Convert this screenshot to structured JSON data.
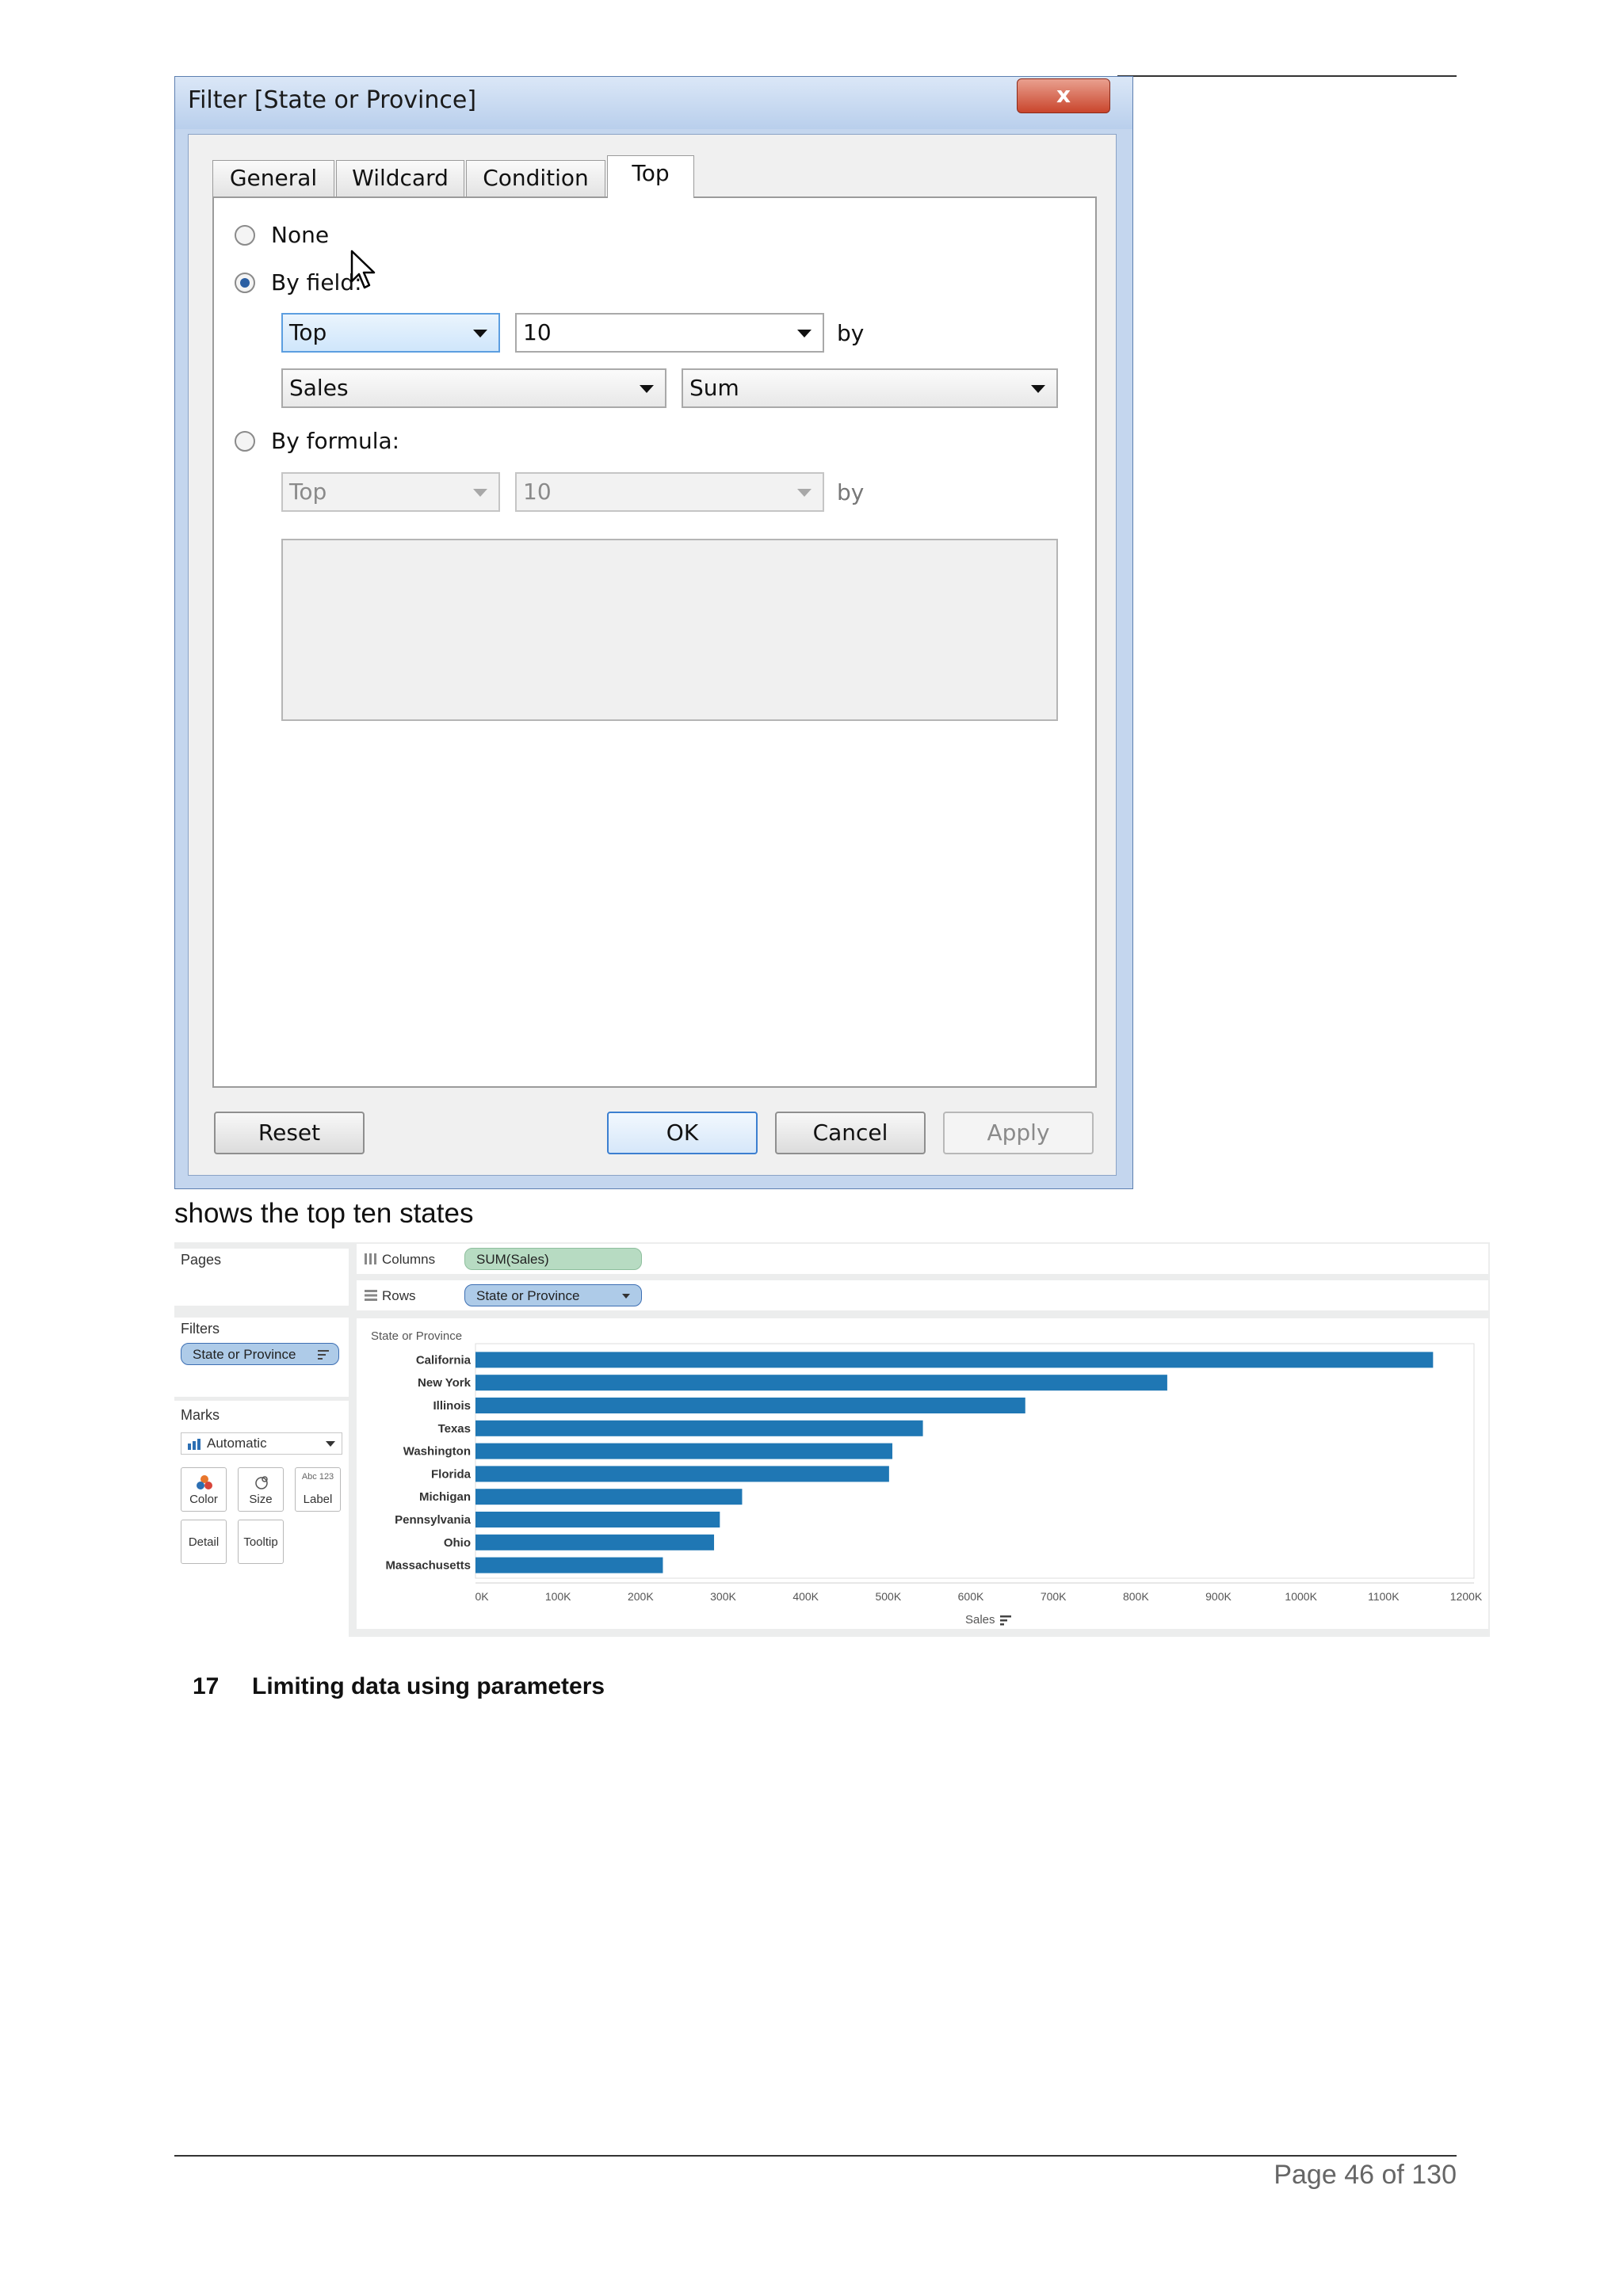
{
  "dialog": {
    "title": "Filter [State or Province]",
    "close_glyph": "x",
    "tabs": [
      {
        "label": "General"
      },
      {
        "label": "Wildcard"
      },
      {
        "label": "Condition"
      },
      {
        "label": "Top"
      }
    ],
    "active_tab": "Top",
    "options": {
      "none_label": "None",
      "by_field_label": "By field:",
      "by_formula_label": "By formula:",
      "selected": "By field:"
    },
    "by_field": {
      "direction": "Top",
      "count": "10",
      "by": "by",
      "field": "Sales",
      "aggregation": "Sum"
    },
    "by_formula": {
      "direction": "Top",
      "count": "10",
      "by": "by",
      "formula": ""
    },
    "buttons": {
      "reset": "Reset",
      "ok": "OK",
      "cancel": "Cancel",
      "apply": "Apply"
    }
  },
  "caption": "shows the top ten states",
  "tableau": {
    "pages_label": "Pages",
    "filters_label": "Filters",
    "filter_pill": "State or Province",
    "marks_label": "Marks",
    "mark_type": "Automatic",
    "mark_cards": [
      "Color",
      "Size",
      "Label",
      "Detail",
      "Tooltip"
    ],
    "label_icon_text": "Abc 123",
    "columns_label": "Columns",
    "columns_pill": "SUM(Sales)",
    "rows_label": "Rows",
    "rows_pill": "State or Province",
    "colors": {
      "bar": "#1f77b4",
      "columns_pill": "#b7dbc2",
      "rows_pill": "#aecbe8"
    }
  },
  "chart_data": {
    "type": "bar",
    "orientation": "horizontal",
    "title": "",
    "ylabel": "State or Province",
    "xlabel": "Sales",
    "categories": [
      "California",
      "New York",
      "Illinois",
      "Texas",
      "Washington",
      "Florida",
      "Michigan",
      "Pennsylvania",
      "Ohio",
      "Massachusetts"
    ],
    "values": [
      1160000,
      838000,
      666000,
      542000,
      505000,
      501000,
      323000,
      296000,
      289000,
      227000
    ],
    "xlim": [
      0,
      1200000
    ],
    "ticks": [
      "0K",
      "100K",
      "200K",
      "300K",
      "400K",
      "500K",
      "600K",
      "700K",
      "800K",
      "900K",
      "1000K",
      "1100K",
      "1200K"
    ],
    "grid": false
  },
  "section": {
    "number": "17",
    "title": "Limiting data using parameters"
  },
  "footer": {
    "page": "Page 46 of 130"
  }
}
